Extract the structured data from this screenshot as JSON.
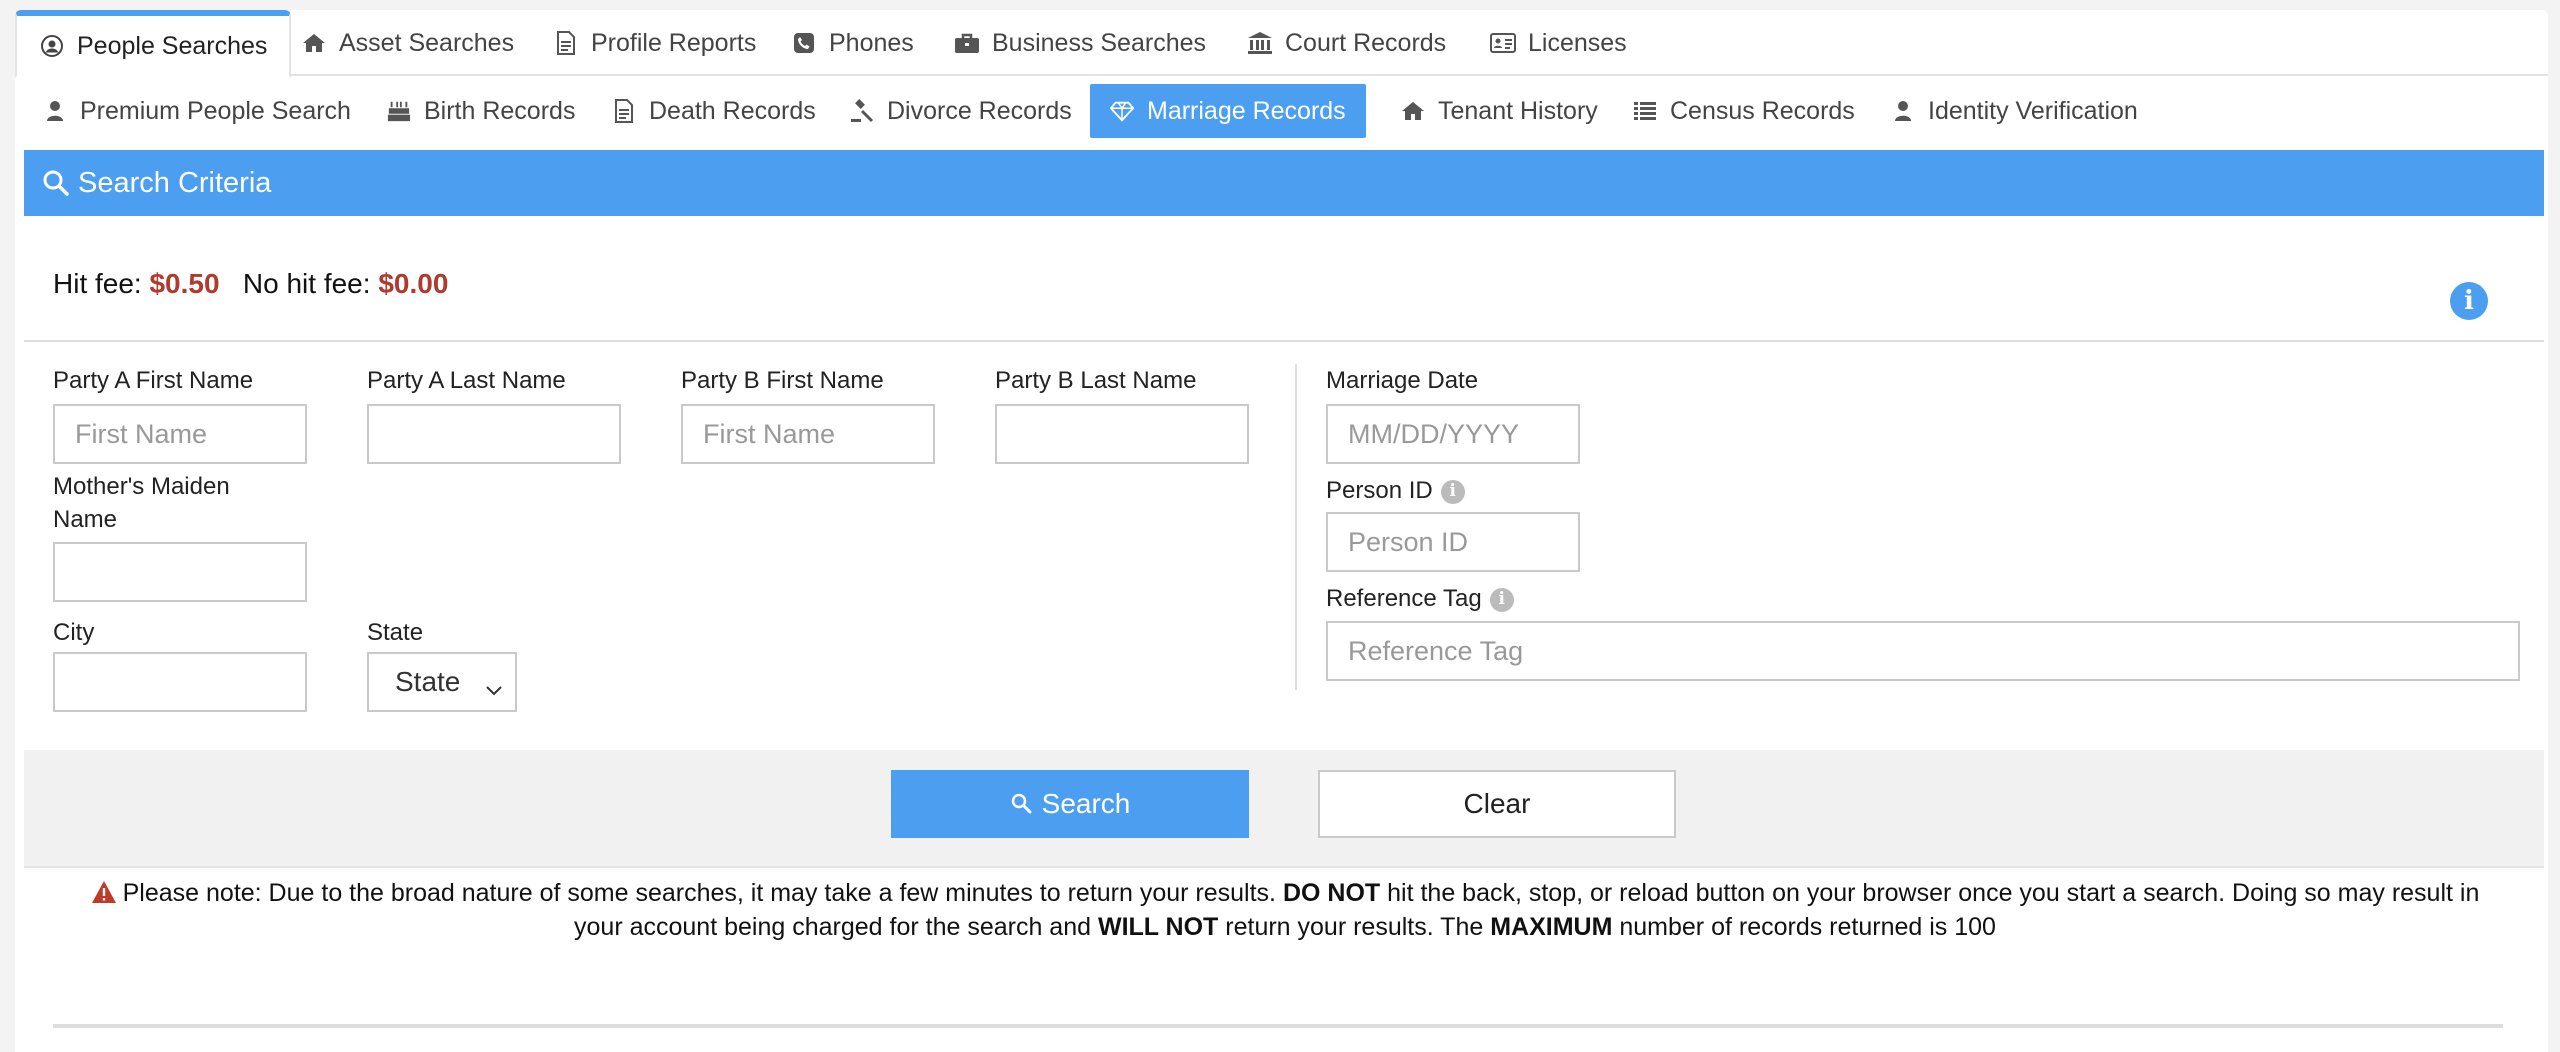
{
  "top_tabs": [
    {
      "label": "People Searches",
      "icon": "user-circle-icon",
      "active": true
    },
    {
      "label": "Asset Searches",
      "icon": "home-icon"
    },
    {
      "label": "Profile Reports",
      "icon": "document-icon"
    },
    {
      "label": "Phones",
      "icon": "phone-icon"
    },
    {
      "label": "Business Searches",
      "icon": "briefcase-icon"
    },
    {
      "label": "Court Records",
      "icon": "courthouse-icon"
    },
    {
      "label": "Licenses",
      "icon": "id-card-icon"
    }
  ],
  "sub_tabs": [
    {
      "label": "Premium People Search",
      "icon": "user-icon"
    },
    {
      "label": "Birth Records",
      "icon": "birthday-cake-icon"
    },
    {
      "label": "Death Records",
      "icon": "document-icon"
    },
    {
      "label": "Divorce Records",
      "icon": "gavel-icon"
    },
    {
      "label": "Marriage Records",
      "icon": "diamond-icon",
      "active": true
    },
    {
      "label": "Tenant History",
      "icon": "home-icon"
    },
    {
      "label": "Census Records",
      "icon": "list-icon"
    },
    {
      "label": "Identity Verification",
      "icon": "user-icon"
    }
  ],
  "panel": {
    "title": "Search Criteria",
    "hit_fee_label": "Hit fee:",
    "hit_fee_value": "$0.50",
    "no_hit_fee_label": "No hit fee:",
    "no_hit_fee_value": "$0.00"
  },
  "form": {
    "party_a_first": {
      "label": "Party A First Name",
      "placeholder": "First Name"
    },
    "party_a_last": {
      "label": "Party A Last Name",
      "placeholder": ""
    },
    "party_b_first": {
      "label": "Party B First Name",
      "placeholder": "First Name"
    },
    "party_b_last": {
      "label": "Party B Last Name",
      "placeholder": ""
    },
    "mothers_maiden": {
      "label_line1": "Mother's Maiden",
      "label_line2": "Name",
      "placeholder": ""
    },
    "city": {
      "label": "City",
      "placeholder": ""
    },
    "state": {
      "label": "State",
      "value": "State"
    },
    "marriage_date": {
      "label": "Marriage Date",
      "placeholder": "MM/DD/YYYY"
    },
    "person_id": {
      "label": "Person ID",
      "placeholder": "Person ID"
    },
    "reference_tag": {
      "label": "Reference Tag",
      "placeholder": "Reference Tag"
    }
  },
  "actions": {
    "search_label": "Search",
    "clear_label": "Clear"
  },
  "note": {
    "part1": "Please note: Due to the broad nature of some searches, it may take a few minutes to return your results. ",
    "bold1": "DO NOT",
    "part2": " hit the back, stop, or reload button on your browser once you start a search. Doing so may result in your account being charged for the search and ",
    "bold2": "WILL NOT",
    "part3": " return your results. The ",
    "bold3": "MAXIMUM",
    "part4": " number of records returned is 100"
  },
  "colors": {
    "accent": "#4c9ff0",
    "fee": "#b03a2e",
    "warning": "#c0392b"
  }
}
